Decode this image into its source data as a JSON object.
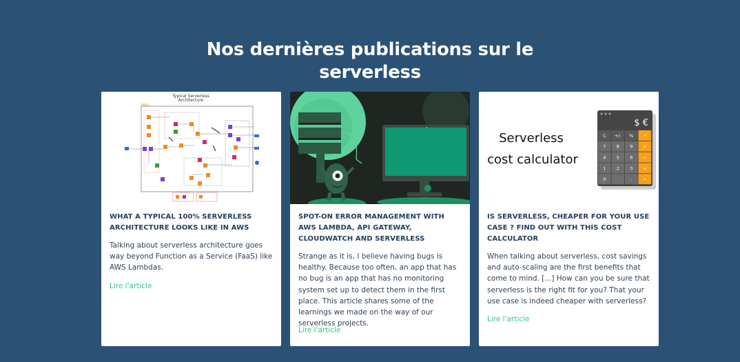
{
  "section": {
    "title_line1": "Nos dernières publications sur le",
    "title_line2": "serverless"
  },
  "articles": [
    {
      "title": "WHAT A TYPICAL 100% SERVERLESS ARCHITECTURE LOOKS LIKE IN AWS",
      "excerpt": "Talking about serverless architecture goes way beyond Function as a Service (FaaS) like AWS Lambdas.",
      "link_label": "Lire l'article",
      "image": {
        "title_line1": "Typical Serverless",
        "title_line2": "Architecture",
        "badge": "AWS"
      }
    },
    {
      "title": "SPOT-ON ERROR MANAGEMENT WITH AWS LAMBDA, API GATEWAY, CLOUDWATCH AND SERVERLESS",
      "excerpt": "Strange as it is, I believe having bugs is healthy. Because too often, an app that has no bug is an app that has no monitoring system set up to detect them in the first place. This article shares some of the learnings we made on the way of our serverless projects.",
      "link_label": "Lire l'article"
    },
    {
      "title": "IS SERVERLESS, CHEAPER FOR YOUR USE CASE ? FIND OUT WITH THIS COST CALCULATOR",
      "excerpt": "When talking about serverless, cost savings and auto-scaling are the first benefits that come to mind. [...] How can you be sure that serverless is the right fit for you? That your use case is indeed cheaper with serverless?",
      "link_label": "Lire l'article",
      "image": {
        "label_line1": "Serverless",
        "label_line2": "cost calculator",
        "display": "$ €",
        "keys": [
          "C",
          "+/-",
          "%",
          "÷",
          "7",
          "8",
          "9",
          "×",
          "4",
          "5",
          "6",
          "−",
          "1",
          "2",
          "3",
          "+",
          "0",
          "",
          ".",
          "="
        ]
      }
    }
  ],
  "colors": {
    "background": "#2b5175",
    "card_title": "#21405f",
    "link": "#2ec98a",
    "calc_orange": "#f7a01a"
  }
}
